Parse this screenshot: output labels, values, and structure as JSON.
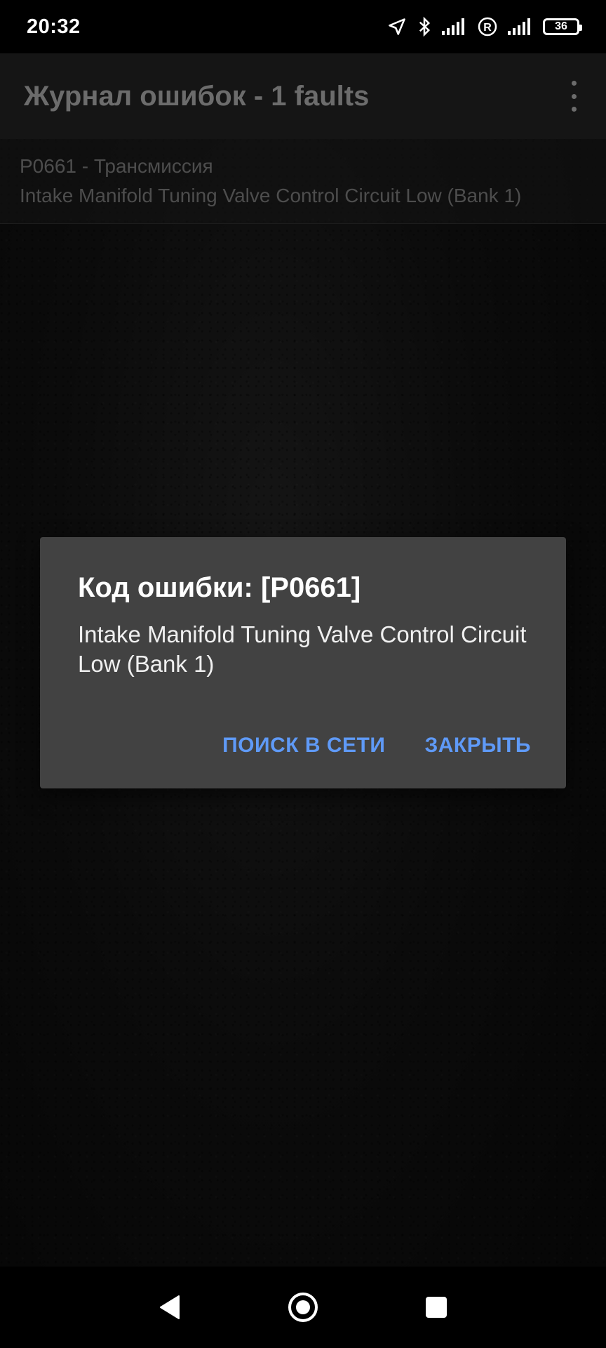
{
  "status_bar": {
    "time": "20:32",
    "battery": "36",
    "icons": [
      "location-arrow-icon",
      "bluetooth-icon",
      "signal-icon",
      "roaming-icon",
      "signal-icon",
      "battery-icon"
    ]
  },
  "app_bar": {
    "title": "Журнал ошибок - 1 faults",
    "menu_icon": "more-vert-icon"
  },
  "faults": [
    {
      "title": "P0661 - Трансмиссия",
      "description": "Intake Manifold Tuning Valve Control Circuit Low (Bank 1)"
    }
  ],
  "dialog": {
    "title": "Код ошибки: [P0661]",
    "message": "Intake Manifold Tuning Valve Control Circuit Low (Bank 1)",
    "search_button": "ПОИСК В СЕТИ",
    "close_button": "ЗАКРЫТЬ",
    "accent_color": "#5f9af7"
  },
  "nav_bar": {
    "icons": [
      "back-icon",
      "home-icon",
      "recents-icon"
    ]
  }
}
